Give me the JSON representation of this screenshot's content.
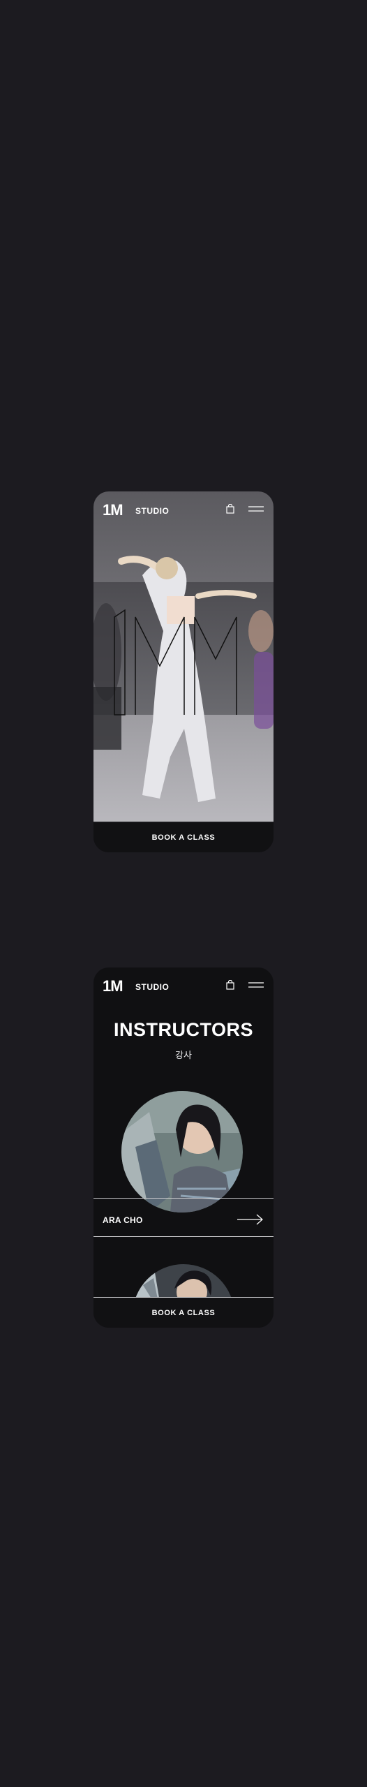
{
  "brand": {
    "logo": "1M",
    "sub": "STUDIO"
  },
  "icons": {
    "cart": "shopping-bag-icon",
    "menu": "hamburger-menu-icon",
    "arrow": "arrow-right-icon"
  },
  "colors": {
    "page_bg": "#1c1b20",
    "phone_bg": "#101012",
    "text": "#ffffff"
  },
  "screen1": {
    "cta_label": "BOOK A CLASS"
  },
  "screen2": {
    "title": "INSTRUCTORS",
    "subtitle": "강사",
    "instructors": [
      {
        "name": "ARA CHO"
      }
    ],
    "cta_label": "BOOK A CLASS"
  }
}
